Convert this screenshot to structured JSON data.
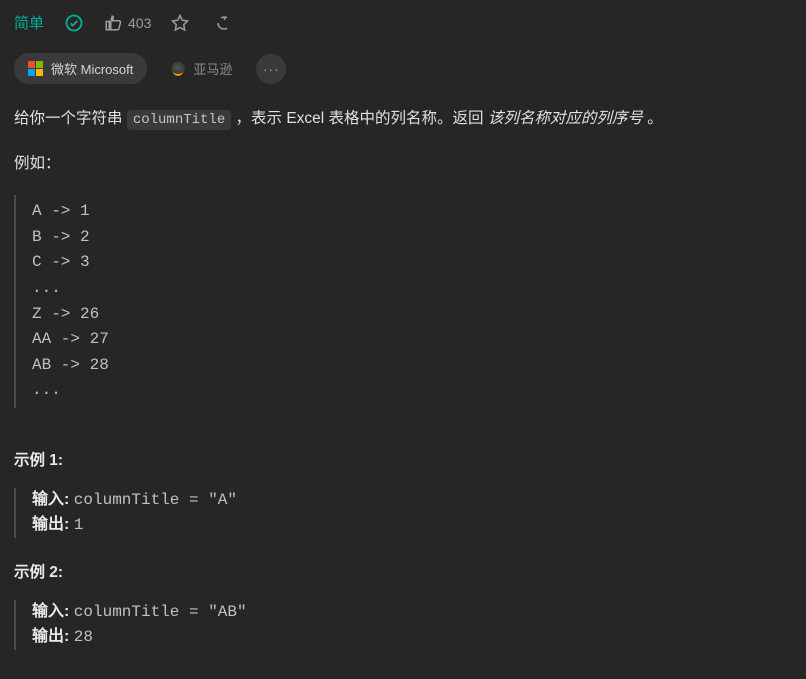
{
  "header": {
    "difficulty": "简单",
    "likes": "403"
  },
  "tags": {
    "microsoft": "微软 Microsoft",
    "amazon": "亚马逊",
    "more": "···"
  },
  "intro": {
    "p1_a": "给你一个字符串 ",
    "code": "columnTitle",
    "p1_b": " ，表示 Excel 表格中的列名称。返回 ",
    "italic": "该列名称对应的列序号",
    "p1_c": " 。",
    "p2": "例如："
  },
  "mapping": "A -> 1\nB -> 2\nC -> 3\n...\nZ -> 26\nAA -> 27\nAB -> 28 \n...",
  "examples": [
    {
      "title": "示例 1:",
      "input_lbl": "输入: ",
      "input_val": "columnTitle = \"A\"",
      "output_lbl": "输出: ",
      "output_val": "1"
    },
    {
      "title": "示例 2:",
      "input_lbl": "输入: ",
      "input_val": "columnTitle = \"AB\"",
      "output_lbl": "输出: ",
      "output_val": "28"
    }
  ]
}
